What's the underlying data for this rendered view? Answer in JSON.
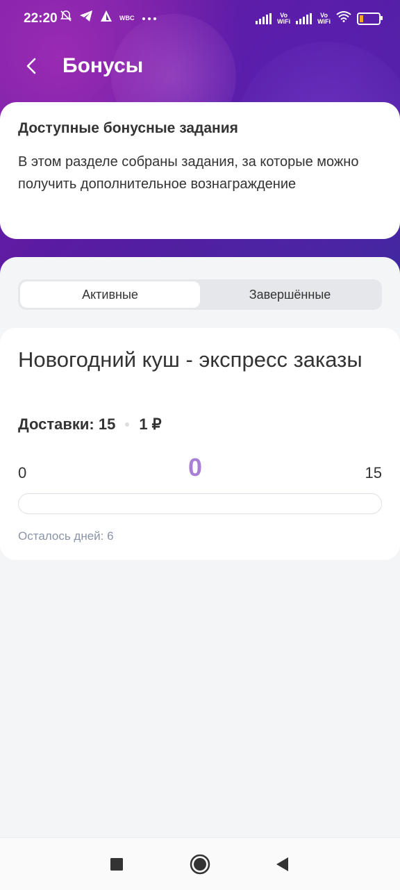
{
  "statusbar": {
    "time": "22:20",
    "left_icons": [
      "muted-bell-icon",
      "telegram-icon",
      "triangle-app-icon",
      "wbc-icon",
      "more-dots-icon"
    ],
    "wbc": "WBC",
    "right_icons": [
      "signal-icon",
      "vowifi-icon",
      "signal-icon",
      "vowifi-icon",
      "wifi-icon",
      "battery-icon"
    ],
    "vowifi_top": "Vo",
    "vowifi_bottom": "WiFi",
    "battery_level": 0.2,
    "battery_color": "#f5a623"
  },
  "header": {
    "title": "Бонусы"
  },
  "info": {
    "title": "Доступные бонусные задания",
    "description": "В этом разделе собраны задания, за которые можно получить дополнительное вознаграждение"
  },
  "tabs": [
    {
      "label": "Активные",
      "active": true
    },
    {
      "label": "Завершённые",
      "active": false
    }
  ],
  "task": {
    "title": "Новогодний куш - экспресс заказы",
    "deliveries_label": "Доставки: 15",
    "reward": "1 ₽",
    "progress_min": "0",
    "progress_current": "0",
    "progress_max": "15",
    "progress_fraction": 0,
    "days_left": "Осталось дней: 6"
  },
  "navbar": {
    "icons": [
      "recent-apps-icon",
      "home-icon",
      "back-icon"
    ]
  },
  "colors": {
    "accent": "#a97fd6",
    "hero_start": "#7a1fa6",
    "hero_end": "#3d2a9e"
  }
}
